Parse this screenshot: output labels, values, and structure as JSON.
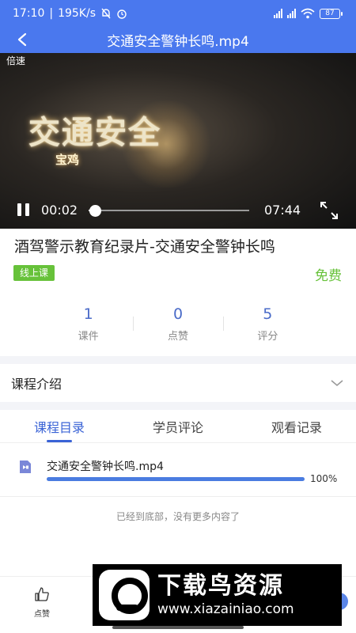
{
  "status_bar": {
    "time": "17:10",
    "speed": "195K/s",
    "battery": "87"
  },
  "nav": {
    "title": "交通安全警钟长鸣.mp4",
    "back_icon": "chevron-left-icon"
  },
  "video": {
    "speed_label": "倍速",
    "overlay_title": "交通安全",
    "overlay_subtitle": "宝鸡",
    "current_time": "00:02",
    "total_time": "07:44",
    "progress": 0.01
  },
  "course": {
    "title": "酒驾警示教育纪录片-交通安全警钟长鸣",
    "tag": "线上课",
    "price": "免费",
    "stats": [
      {
        "value": "1",
        "label": "课件"
      },
      {
        "value": "0",
        "label": "点赞"
      },
      {
        "value": "5",
        "label": "评分"
      }
    ]
  },
  "intro": {
    "label": "课程介绍"
  },
  "tabs": [
    {
      "label": "课程目录"
    },
    {
      "label": "学员评论"
    },
    {
      "label": "观看记录"
    }
  ],
  "lessons": [
    {
      "name": "交通安全警钟长鸣.mp4",
      "progress": 1.0,
      "percent": "100%"
    }
  ],
  "end_note": "已经到底部，没有更多内容了",
  "bottom_bar": {
    "like_label": "点赞"
  },
  "watermark": {
    "text": "下载鸟资源",
    "url": "www.xiazainiao.com"
  },
  "colors": {
    "primary": "#4a78ee",
    "accent_green": "#67c23a",
    "stat_blue": "#4a6bc8"
  }
}
